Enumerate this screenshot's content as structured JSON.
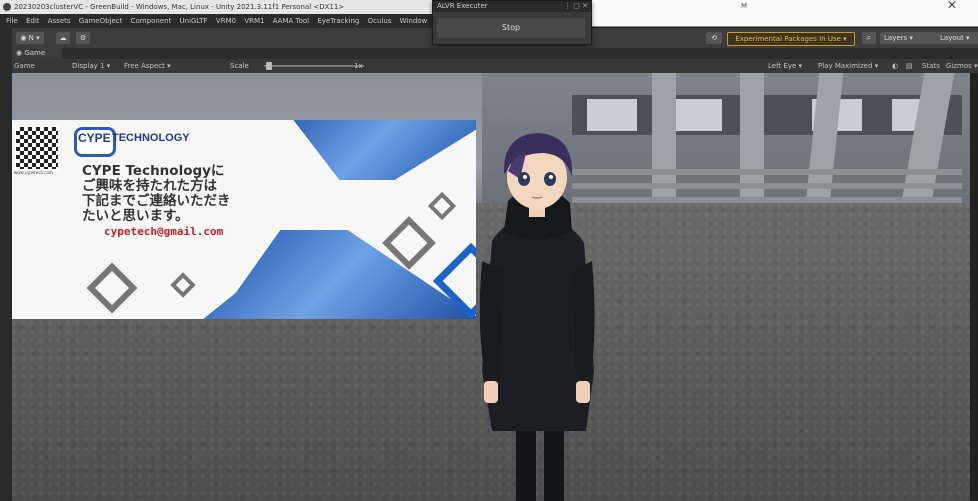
{
  "window": {
    "title": "20230203clusterVC - GreenBuild - Windows, Mac, Linux - Unity 2021.3.11f1 Personal <DX11>"
  },
  "external_window": {
    "mark": "M",
    "close_glyph": "✕"
  },
  "menubar": {
    "items": [
      "File",
      "Edit",
      "Assets",
      "GameObject",
      "Component",
      "UniGLTF",
      "VRM0",
      "VRM1",
      "AAMA Tool",
      "EyeTracking",
      "Oculus",
      "Window"
    ]
  },
  "toolbar": {
    "account_label": "◉ N ▾",
    "cloud_label": "☁",
    "settings_label": "⚙",
    "history_label": "⟲",
    "packages_label": "Experimental Packages In Use ▾",
    "search_label": "⌕",
    "layers_label": "Layers ▾",
    "layout_label": "Layout ▾"
  },
  "alvr": {
    "title": "ALVR Executer",
    "controls": "⋮ ▢ ✕",
    "stop_label": "Stop"
  },
  "tabs": {
    "game_label": "◉ Game"
  },
  "game_toolbar": {
    "view_mode": "Game",
    "display": "Display 1 ▾",
    "aspect": "Free Aspect ▾",
    "scale_label": "Scale",
    "scale_value": "1x",
    "eye": "Left Eye ▾",
    "play_mode": "Play Maximized ▾",
    "mute_icon": "◐",
    "vsync_icon": "▤",
    "stats": "Stats",
    "gizmos": "Gizmos ▾"
  },
  "banner": {
    "qr_caption": "www.cypetech.com",
    "logo_prefix": "CYPE",
    "logo_rest": "TECHNOLOGY",
    "line1": "CYPE Technologyに",
    "line2": "ご興味を持たれた方は",
    "line3": "下記までご連絡いただき",
    "line4": "たいと思います。",
    "email": "cypetech@gmail.com"
  },
  "colors": {
    "accent_warning": "#e8b840",
    "brand_blue": "#1c4ea3",
    "email_red": "#c5201f"
  }
}
